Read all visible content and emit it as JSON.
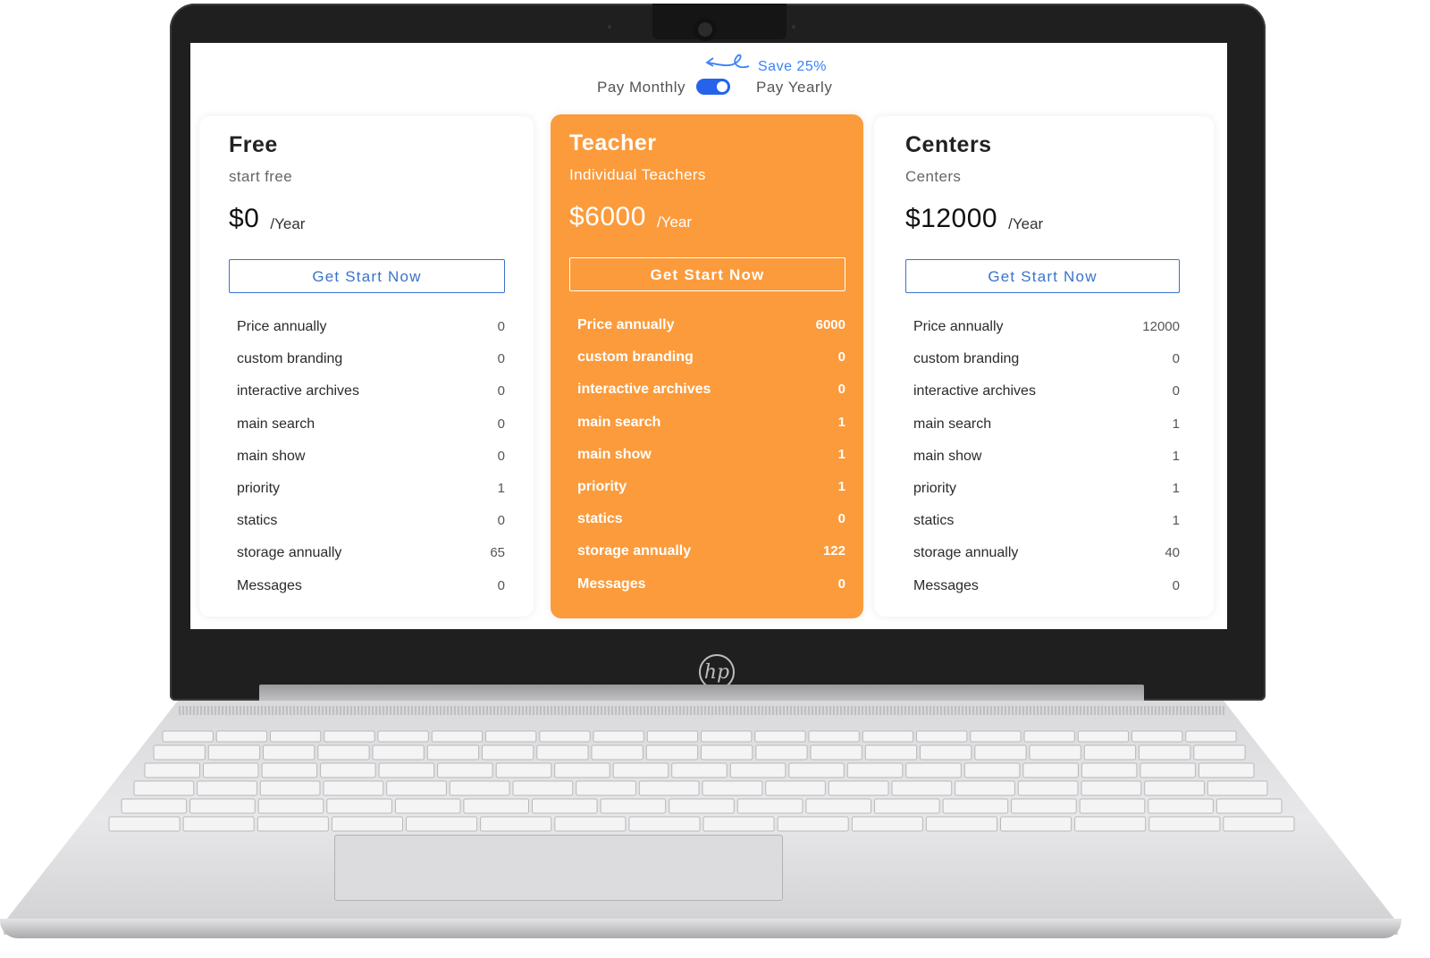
{
  "billing_toggle": {
    "monthly_label": "Pay Monthly",
    "yearly_label": "Pay Yearly",
    "save_label": "Save 25%",
    "selected": "yearly"
  },
  "plans": [
    {
      "name": "Free",
      "subtitle": "start free",
      "price": "$0",
      "period": "/Year",
      "cta": "Get Start Now",
      "features": [
        {
          "label": "Price annually",
          "value": "0"
        },
        {
          "label": "custom branding",
          "value": "0"
        },
        {
          "label": "interactive archives",
          "value": "0"
        },
        {
          "label": "main search",
          "value": "0"
        },
        {
          "label": "main show",
          "value": "0"
        },
        {
          "label": "priority",
          "value": "1"
        },
        {
          "label": "statics",
          "value": "0"
        },
        {
          "label": "storage annually",
          "value": "65"
        },
        {
          "label": "Messages",
          "value": "0"
        }
      ]
    },
    {
      "name": "Teacher",
      "subtitle": "Individual Teachers",
      "price": "$6000",
      "period": "/Year",
      "cta": "Get Start Now",
      "highlighted": true,
      "features": [
        {
          "label": "Price annually",
          "value": "6000"
        },
        {
          "label": "custom branding",
          "value": "0"
        },
        {
          "label": "interactive archives",
          "value": "0"
        },
        {
          "label": "main search",
          "value": "1"
        },
        {
          "label": "main show",
          "value": "1"
        },
        {
          "label": "priority",
          "value": "1"
        },
        {
          "label": "statics",
          "value": "0"
        },
        {
          "label": "storage annually",
          "value": "122"
        },
        {
          "label": "Messages",
          "value": "0"
        }
      ]
    },
    {
      "name": "Centers",
      "subtitle": "Centers",
      "price": "$12000",
      "period": "/Year",
      "cta": "Get Start Now",
      "features": [
        {
          "label": "Price annually",
          "value": "12000"
        },
        {
          "label": "custom branding",
          "value": "0"
        },
        {
          "label": "interactive archives",
          "value": "0"
        },
        {
          "label": "main search",
          "value": "1"
        },
        {
          "label": "main show",
          "value": "1"
        },
        {
          "label": "priority",
          "value": "1"
        },
        {
          "label": "statics",
          "value": "1"
        },
        {
          "label": "storage annually",
          "value": "40"
        },
        {
          "label": "Messages",
          "value": "0"
        }
      ]
    }
  ],
  "colors": {
    "accent": "#2563eb",
    "highlight_card": "#fb9b3c",
    "cta_border": "#3b73c9",
    "save_text": "#3b82f6"
  },
  "device": {
    "brand_logo": "hp"
  }
}
